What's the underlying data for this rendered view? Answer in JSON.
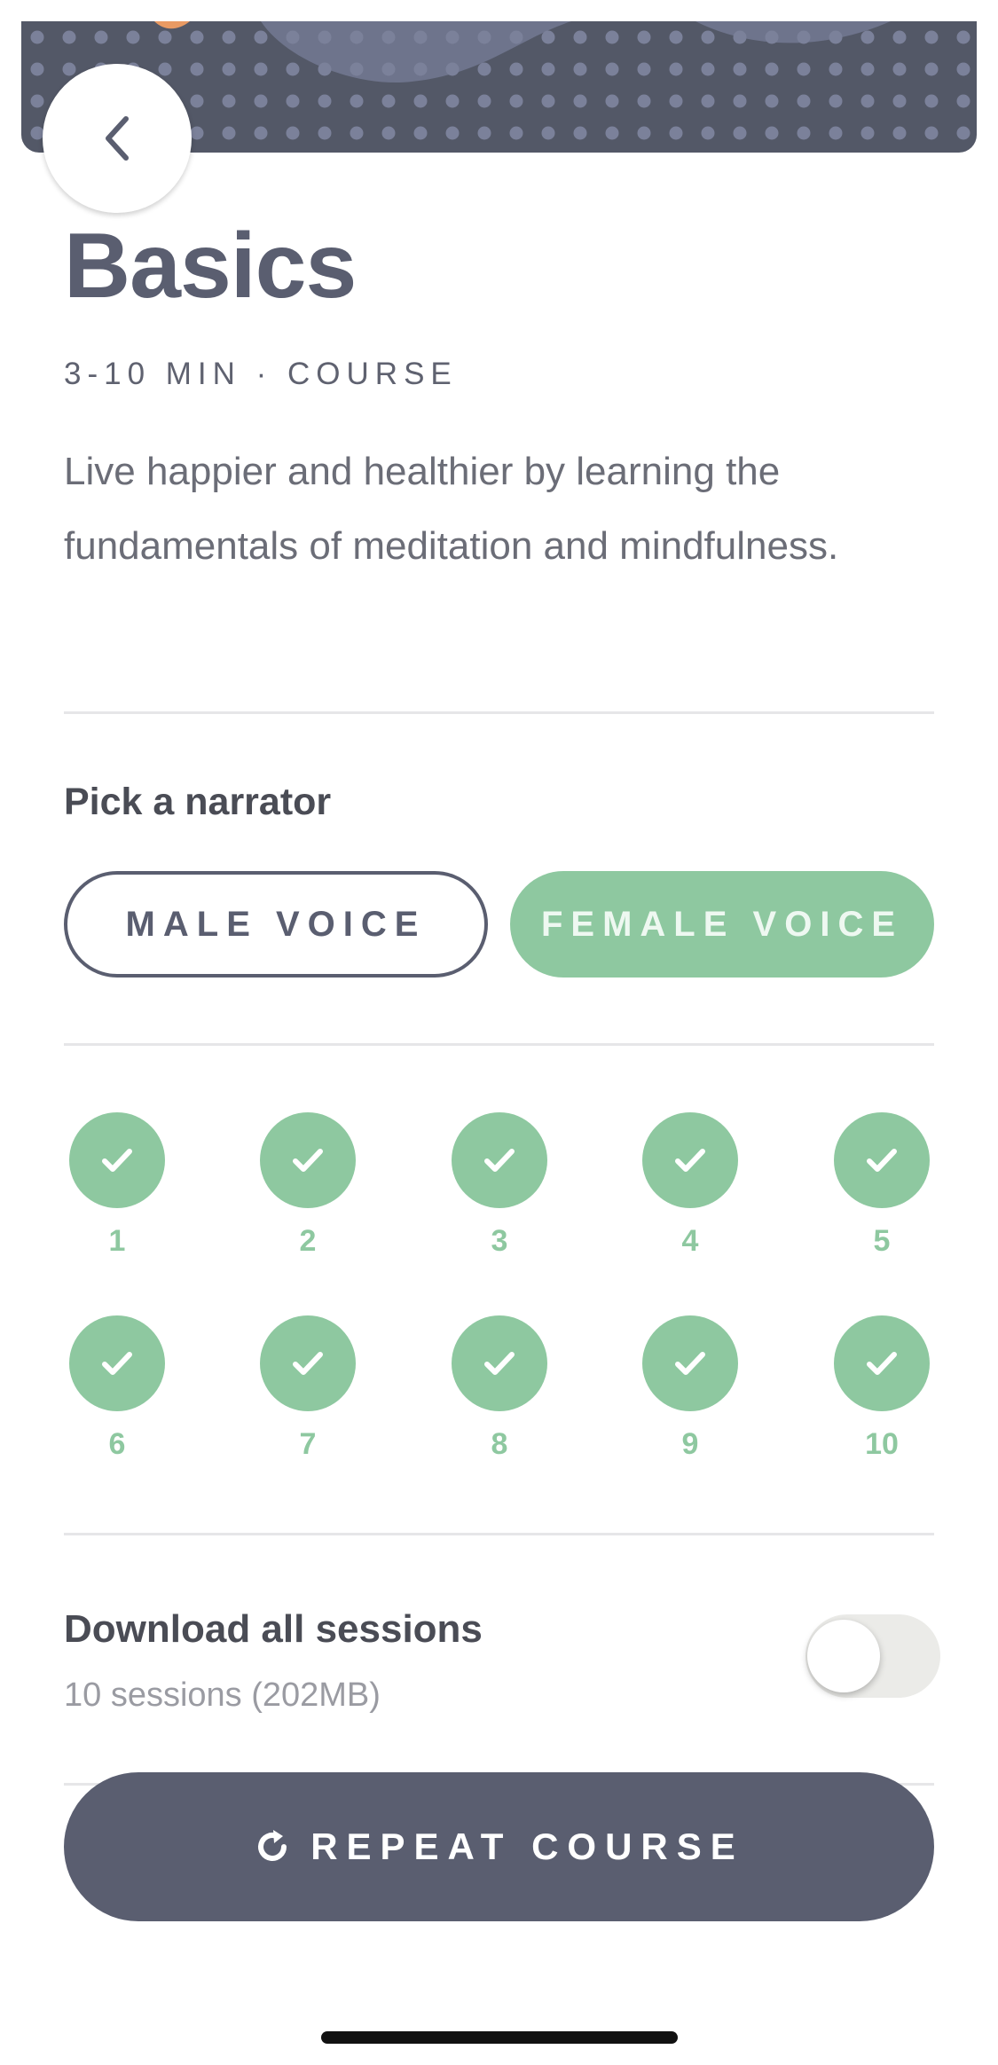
{
  "header": {
    "back_icon": "chevron-left-icon",
    "illustration": "dotted-pattern-banner"
  },
  "course": {
    "title": "Basics",
    "meta": "3-10 MIN · COURSE",
    "description": "Live happier and healthier by learning the fundamentals of meditation and mindfulness."
  },
  "narrator": {
    "heading": "Pick a narrator",
    "male_label": "MALE VOICE",
    "female_label": "FEMALE VOICE",
    "selected": "FEMALE VOICE"
  },
  "sessions": [
    {
      "label": "1",
      "completed": true
    },
    {
      "label": "2",
      "completed": true
    },
    {
      "label": "3",
      "completed": true
    },
    {
      "label": "4",
      "completed": true
    },
    {
      "label": "5",
      "completed": true
    },
    {
      "label": "6",
      "completed": true
    },
    {
      "label": "7",
      "completed": true
    },
    {
      "label": "8",
      "completed": true
    },
    {
      "label": "9",
      "completed": true
    },
    {
      "label": "10",
      "completed": true
    }
  ],
  "download": {
    "title": "Download all sessions",
    "subtitle": "10 sessions (202MB)",
    "enabled": false
  },
  "repeat": {
    "icon": "refresh-icon",
    "label": "REPEAT COURSE"
  },
  "colors": {
    "primary": "#5a5e70",
    "accent_green": "#8ec8a0",
    "divider": "#e6e6e8"
  }
}
